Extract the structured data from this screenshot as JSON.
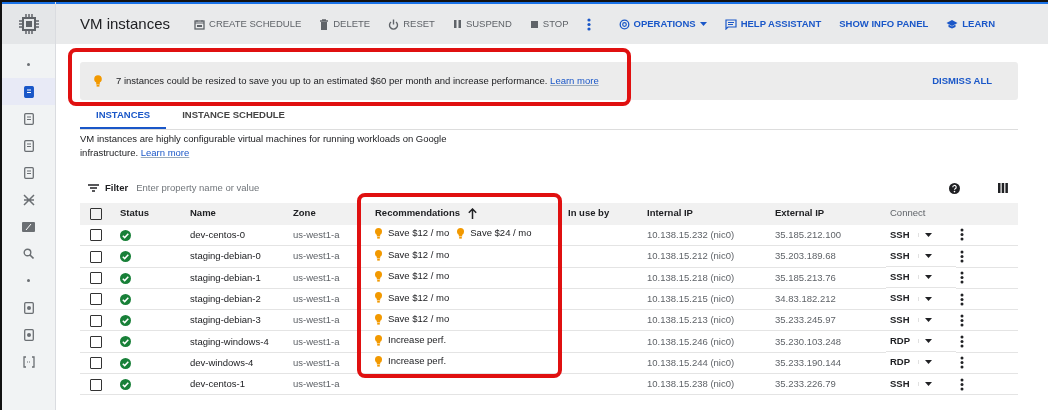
{
  "window": {
    "title": "VM instances"
  },
  "toolbar": [
    {
      "label": "CREATE SCHEDULE",
      "kind": "calendar"
    },
    {
      "label": "DELETE",
      "kind": "trash"
    },
    {
      "label": "RESET",
      "kind": "power"
    },
    {
      "label": "SUSPEND",
      "kind": "pause"
    },
    {
      "label": "STOP",
      "kind": "stop"
    }
  ],
  "toolbar_right": [
    {
      "label": "OPERATIONS",
      "kind": "operations"
    },
    {
      "label": "HELP ASSISTANT",
      "kind": "help"
    },
    {
      "label": "SHOW INFO PANEL",
      "kind": "plain"
    },
    {
      "label": "LEARN",
      "kind": "learn"
    }
  ],
  "sidebar": {
    "items": [
      {
        "kind": "dot",
        "selected": false
      },
      {
        "kind": "doc",
        "selected": true
      },
      {
        "kind": "doc",
        "selected": false
      },
      {
        "kind": "doc",
        "selected": false
      },
      {
        "kind": "doc",
        "selected": false
      },
      {
        "kind": "cross",
        "selected": false
      },
      {
        "kind": "percent",
        "selected": false
      },
      {
        "kind": "search",
        "selected": false
      },
      {
        "kind": "dot",
        "selected": false
      },
      {
        "kind": "disk",
        "selected": false
      },
      {
        "kind": "disk",
        "selected": false
      },
      {
        "kind": "bracket",
        "selected": false
      }
    ]
  },
  "banner": {
    "text": "7 instances could be resized to save you up to an estimated $60 per month and increase performance.",
    "link": "Learn more",
    "action": "DISMISS ALL",
    "highlighted": true
  },
  "tabs": [
    {
      "label": "INSTANCES",
      "selected": true
    },
    {
      "label": "INSTANCE SCHEDULE",
      "selected": false
    }
  ],
  "description": {
    "text": "VM instances are highly configurable virtual machines for running workloads on Google infrastructure.",
    "link": "Learn more"
  },
  "filter": {
    "label": "Filter",
    "placeholder": "Enter property name or value"
  },
  "table": {
    "select_all_checked": false,
    "columns": [
      {
        "label": "Status"
      },
      {
        "label": "Name"
      },
      {
        "label": "Zone"
      },
      {
        "label": "Recommendations",
        "sorted": true,
        "highlighted": true
      },
      {
        "label": "In use by"
      },
      {
        "label": "Internal IP"
      },
      {
        "label": "External IP"
      },
      {
        "label": "Connect",
        "muted": true
      }
    ],
    "rows": [
      {
        "checked": false,
        "running": true,
        "name": "dev-centos-0",
        "zone": "us-west1-a",
        "recommendations": [
          "Save $12 / mo",
          "Save $24 / mo"
        ],
        "internal_ip": "10.138.15.232 (nic0)",
        "external_ip": "35.185.212.100",
        "connect": "SSH"
      },
      {
        "checked": false,
        "running": true,
        "name": "staging-debian-0",
        "zone": "us-west1-a",
        "recommendations": [
          "Save $12 / mo"
        ],
        "internal_ip": "10.138.15.212 (nic0)",
        "external_ip": "35.203.189.68",
        "connect": "SSH"
      },
      {
        "checked": false,
        "running": true,
        "name": "staging-debian-1",
        "zone": "us-west1-a",
        "recommendations": [
          "Save $12 / mo"
        ],
        "internal_ip": "10.138.15.218 (nic0)",
        "external_ip": "35.185.213.76",
        "connect": "SSH"
      },
      {
        "checked": false,
        "running": true,
        "name": "staging-debian-2",
        "zone": "us-west1-a",
        "recommendations": [
          "Save $12 / mo"
        ],
        "internal_ip": "10.138.15.215 (nic0)",
        "external_ip": "34.83.182.212",
        "connect": "SSH"
      },
      {
        "checked": false,
        "running": true,
        "name": "staging-debian-3",
        "zone": "us-west1-a",
        "recommendations": [
          "Save $12 / mo"
        ],
        "internal_ip": "10.138.15.213 (nic0)",
        "external_ip": "35.233.245.97",
        "connect": "SSH"
      },
      {
        "checked": false,
        "running": true,
        "name": "staging-windows-4",
        "zone": "us-west1-a",
        "recommendations": [
          "Increase perf."
        ],
        "internal_ip": "10.138.15.246 (nic0)",
        "external_ip": "35.230.103.248",
        "connect": "RDP"
      },
      {
        "checked": false,
        "running": true,
        "name": "dev-windows-4",
        "zone": "us-west1-a",
        "recommendations": [
          "Increase perf."
        ],
        "internal_ip": "10.138.15.244 (nic0)",
        "external_ip": "35.233.190.144",
        "connect": "RDP"
      },
      {
        "checked": false,
        "running": true,
        "name": "dev-centos-1",
        "zone": "us-west1-a",
        "recommendations": [],
        "internal_ip": "10.138.15.238 (nic0)",
        "external_ip": "35.233.226.79",
        "connect": "SSH"
      }
    ]
  }
}
